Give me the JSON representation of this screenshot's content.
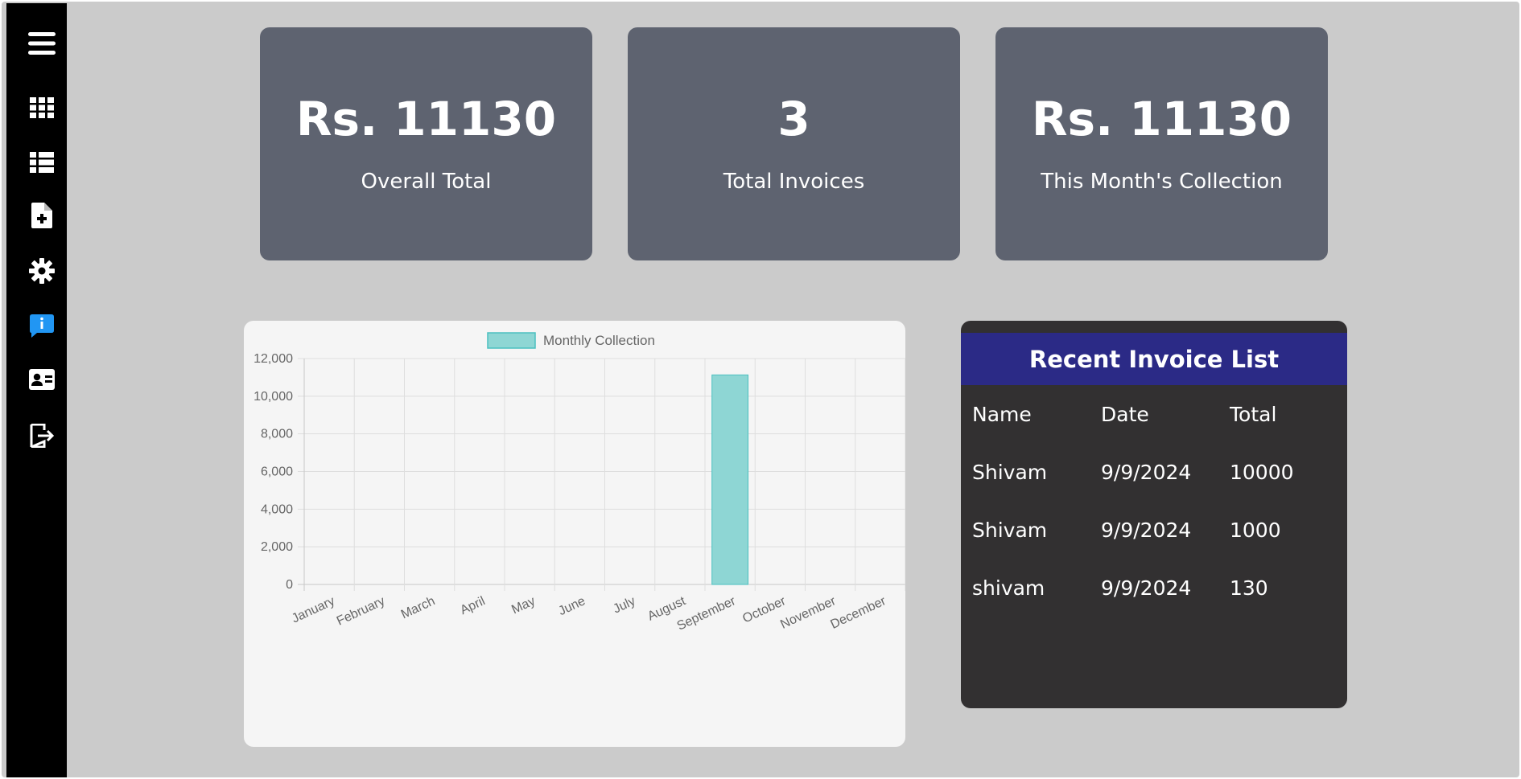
{
  "sidebar": {
    "icons": [
      {
        "name": "menu-icon"
      },
      {
        "name": "grid-icon"
      },
      {
        "name": "list-icon"
      },
      {
        "name": "file-add-icon"
      },
      {
        "name": "gear-icon"
      },
      {
        "name": "info-chat-icon",
        "color": "#2196f3"
      },
      {
        "name": "contact-card-icon"
      },
      {
        "name": "logout-icon"
      }
    ]
  },
  "cards": [
    {
      "value": "Rs. 11130",
      "label": "Overall Total"
    },
    {
      "value": "3",
      "label": "Total Invoices"
    },
    {
      "value": "Rs. 11130",
      "label": "This Month's Collection"
    }
  ],
  "invoices": {
    "title": "Recent Invoice List",
    "headers": [
      "Name",
      "Date",
      "Total"
    ],
    "rows": [
      [
        "Shivam",
        "9/9/2024",
        "10000"
      ],
      [
        "Shivam",
        "9/9/2024",
        "1000"
      ],
      [
        "shivam",
        "9/9/2024",
        "130"
      ]
    ]
  },
  "chart_data": {
    "type": "bar",
    "categories": [
      "January",
      "February",
      "March",
      "April",
      "May",
      "June",
      "July",
      "August",
      "September",
      "October",
      "November",
      "December"
    ],
    "series": [
      {
        "name": "Monthly Collection",
        "values": [
          0,
          0,
          0,
          0,
          0,
          0,
          0,
          0,
          11130,
          0,
          0,
          0
        ],
        "color": "#8ed6d4",
        "border": "#4bc0c0"
      }
    ],
    "ylim": [
      0,
      12000
    ],
    "yticks": [
      0,
      2000,
      4000,
      6000,
      8000,
      10000,
      12000
    ],
    "ytick_labels": [
      "0",
      "2,000",
      "4,000",
      "6,000",
      "8,000",
      "10,000",
      "12,000"
    ],
    "xlabel": "",
    "ylabel": "",
    "grid": true,
    "legend": "top"
  }
}
